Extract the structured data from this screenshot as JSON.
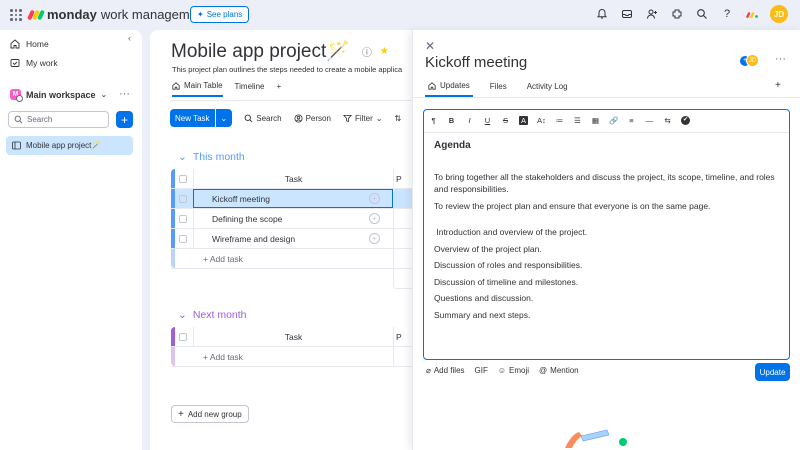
{
  "topbar": {
    "brand": "monday",
    "brand_sub": "work management",
    "see_plans": "See plans",
    "avatar_initials": "JD",
    "icons": [
      "bell-icon",
      "inbox-icon",
      "invite-members-icon",
      "apps-icon",
      "search-icon",
      "help-icon",
      "monday-apps-icon"
    ]
  },
  "sidebar": {
    "home": "Home",
    "my_work": "My work",
    "workspace": "Main workspace",
    "workspace_badge": "M",
    "search_placeholder": "Search",
    "board": "Mobile app project🪄"
  },
  "board": {
    "title": "Mobile app project🪄",
    "description": "This project plan outlines the steps needed to create a mobile applica",
    "views": [
      {
        "label": "Main Table",
        "active": true
      },
      {
        "label": "Timeline",
        "active": false
      }
    ],
    "toolbar": {
      "new_task": "New Task",
      "search": "Search",
      "person": "Person",
      "filter": "Filter"
    },
    "groups": [
      {
        "title": "This month",
        "color": "#579bfc",
        "column_header": "Task",
        "next_col_header": "P",
        "rows": [
          "Kickoff meeting",
          "Defining the scope",
          "Wireframe and design"
        ],
        "add_label": "+ Add task"
      },
      {
        "title": "Next month",
        "color": "#a25ddc",
        "column_header": "Task",
        "next_col_header": "P",
        "rows": [],
        "add_label": "+ Add task"
      }
    ],
    "add_group": "Add new group"
  },
  "panel": {
    "title": "Kickoff meeting",
    "avatar_initials": "JD",
    "tabs": [
      {
        "label": "Updates",
        "active": true
      },
      {
        "label": "Files",
        "active": false
      },
      {
        "label": "Activity Log",
        "active": false
      }
    ],
    "editor_tools": [
      "¶",
      "B",
      "I",
      "U",
      "S",
      "A",
      "A↕",
      "≔",
      "☰",
      "▦",
      "🔗",
      "≡",
      "—",
      "⇆",
      "✔"
    ],
    "agenda_title": "Agenda",
    "goals": [
      "To bring together all the stakeholders and discuss the project, its scope, timeline, and roles and responsibilities.",
      "To review the project plan and ensure that everyone is on the same page."
    ],
    "items": [
      " Introduction and overview of the project.",
      "Overview of the project plan.",
      "Discussion of roles and responsibilities.",
      "Discussion of timeline and milestones.",
      "Questions and discussion.",
      "Summary and next steps."
    ],
    "composer": {
      "add_files": "Add files",
      "gif": "GIF",
      "emoji": "Emoji",
      "mention": "Mention",
      "update": "Update"
    }
  }
}
